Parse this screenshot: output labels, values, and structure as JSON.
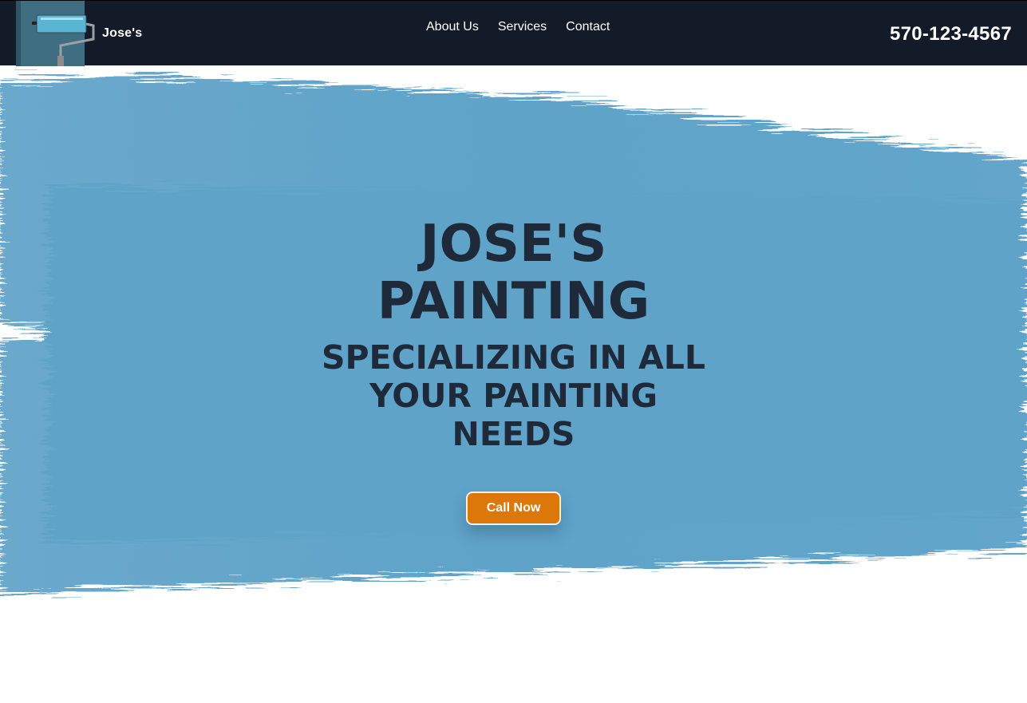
{
  "header": {
    "brand_name": "Jose's",
    "logo_icon": "paint-roller-icon",
    "nav": [
      {
        "label": "About Us"
      },
      {
        "label": "Services"
      },
      {
        "label": "Contact"
      }
    ],
    "phone": "570-123-4567"
  },
  "hero": {
    "title": "JOSE'S PAINTING",
    "subtitle": "SPECIALIZING IN ALL YOUR PAINTING NEEDS",
    "cta_label": "Call Now",
    "brush_icon": "paint-brush-stroke"
  },
  "colors": {
    "navbar_bg": "#131a28",
    "brush_blue": "#5fa3c9",
    "heading": "#1e2a3a",
    "cta": "#dc780a"
  }
}
